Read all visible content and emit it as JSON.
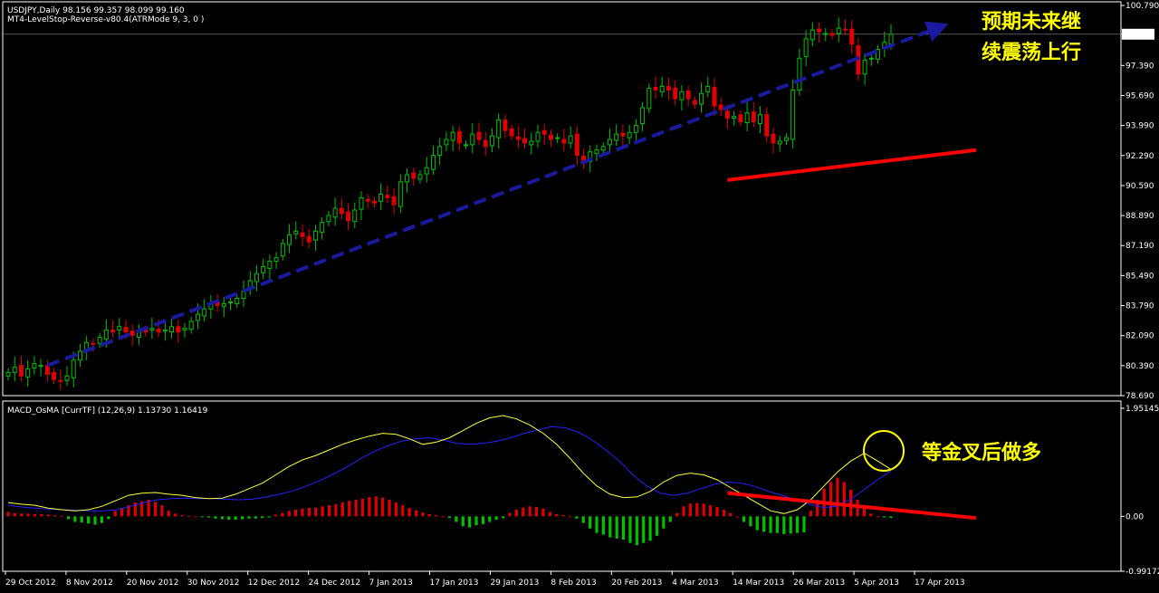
{
  "colors": {
    "background": "#000000",
    "grid": "#ffffff",
    "bull": "#00c000",
    "bear": "#e00000",
    "signal_line": "#ffff33",
    "macd_line": "#2222ff",
    "trend_arrow": "#1a1aa0",
    "highlight": "#ff0000",
    "annotation": "#ffff00"
  },
  "header": {
    "symbol_line": "USDJPY,Daily  98.156 99.357 98.099 99.160",
    "indicator_line": "MT4-LevelStop-Reverse-v80.4(ATRMode 9, 3, 0 )"
  },
  "chart_data": [
    {
      "type": "candlestick",
      "symbol": "USDJPY",
      "timeframe": "Daily",
      "ohlc_last": {
        "open": 98.156,
        "high": 99.357,
        "low": 98.099,
        "close": 99.16
      },
      "current_price_label": "99.160",
      "ylim": [
        78.69,
        100.79
      ],
      "y_ticks": [
        "100.790",
        "99.160",
        "97.390",
        "95.690",
        "93.990",
        "92.290",
        "90.590",
        "88.890",
        "87.190",
        "85.490",
        "83.790",
        "82.090",
        "80.390",
        "78.690"
      ],
      "x_ticks": [
        "29 Oct 2012",
        "8 Nov 2012",
        "20 Nov 2012",
        "30 Nov 2012",
        "12 Dec 2012",
        "24 Dec 2012",
        "7 Jan 2013",
        "17 Jan 2013",
        "29 Jan 2013",
        "8 Feb 2013",
        "20 Feb 2013",
        "4 Mar 2013",
        "14 Mar 2013",
        "26 Mar 2013",
        "5 Apr 2013",
        "17 Apr 2013"
      ],
      "close_path": [
        80.0,
        80.3,
        79.8,
        80.2,
        80.5,
        80.4,
        79.9,
        79.6,
        79.5,
        79.8,
        80.7,
        81.2,
        81.7,
        81.6,
        82.0,
        82.4,
        82.3,
        82.6,
        82.3,
        82.1,
        82.4,
        82.3,
        82.5,
        82.3,
        82.4,
        82.6,
        82.3,
        82.5,
        82.9,
        83.3,
        83.6,
        83.9,
        83.8,
        83.9,
        84.0,
        84.2,
        84.6,
        85.2,
        85.6,
        86.0,
        86.3,
        86.5,
        87.3,
        87.8,
        88.0,
        87.7,
        87.4,
        88.0,
        88.5,
        88.9,
        89.3,
        89.0,
        88.6,
        89.2,
        89.9,
        89.7,
        89.6,
        90.1,
        89.9,
        89.5,
        90.8,
        91.2,
        91.0,
        91.2,
        91.6,
        92.3,
        92.8,
        93.2,
        93.6,
        93.0,
        92.9,
        93.5,
        93.2,
        92.8,
        93.4,
        94.3,
        93.7,
        93.4,
        93.2,
        93.0,
        93.1,
        93.6,
        93.5,
        93.2,
        93.3,
        93.0,
        93.4,
        92.3,
        91.9,
        92.5,
        92.6,
        92.8,
        93.2,
        93.5,
        93.4,
        93.6,
        94.0,
        95.0,
        96.1,
        96.0,
        96.2,
        96.0,
        95.5,
        95.9,
        95.5,
        95.2,
        95.8,
        96.2,
        95.1,
        94.9,
        94.4,
        94.5,
        94.2,
        94.7,
        94.2,
        94.6,
        93.4,
        93.0,
        93.1,
        93.3,
        96.0,
        97.8,
        98.9,
        99.4,
        99.3,
        99.2,
        99.1,
        99.5,
        99.4,
        98.6,
        96.9,
        97.7,
        97.8,
        98.3,
        98.7,
        99.16
      ],
      "trend_arrow": {
        "from": {
          "index": 6,
          "price": 80.4
        },
        "to": {
          "index": 154,
          "price": 99.6
        }
      },
      "highlight_line": {
        "from": {
          "index": 110,
          "price": 90.9
        },
        "to": {
          "index": 148,
          "price": 92.6
        }
      }
    },
    {
      "type": "macd",
      "label": "MACD_OsMA [CurrTF] (12,26,9) 1.13730 1.16419",
      "ylim": [
        -0.99172,
        1.95145
      ],
      "y_ticks": [
        "1.95145",
        "0.00",
        "-0.99172"
      ],
      "osma_histogram": [
        0.08,
        0.06,
        0.05,
        0.05,
        0.04,
        0.04,
        0.03,
        0.02,
        0.01,
        -0.05,
        -0.1,
        -0.11,
        -0.13,
        -0.15,
        -0.12,
        -0.05,
        0.1,
        0.15,
        0.2,
        0.25,
        0.27,
        0.3,
        0.26,
        0.2,
        0.1,
        0.05,
        0.02,
        0.01,
        0.0,
        -0.01,
        -0.02,
        -0.04,
        -0.05,
        -0.06,
        -0.06,
        -0.05,
        -0.04,
        -0.04,
        -0.03,
        -0.02,
        0.03,
        0.06,
        0.1,
        0.12,
        0.14,
        0.15,
        0.16,
        0.18,
        0.2,
        0.22,
        0.25,
        0.28,
        0.3,
        0.32,
        0.35,
        0.36,
        0.34,
        0.3,
        0.25,
        0.2,
        0.15,
        0.11,
        0.07,
        0.04,
        0.02,
        0.0,
        -0.03,
        -0.1,
        -0.18,
        -0.2,
        -0.16,
        -0.14,
        -0.1,
        -0.06,
        -0.03,
        0.06,
        0.12,
        0.16,
        0.18,
        0.17,
        0.14,
        0.08,
        0.04,
        0.02,
        0.0,
        -0.04,
        -0.12,
        -0.22,
        -0.3,
        -0.33,
        -0.38,
        -0.4,
        -0.42,
        -0.48,
        -0.52,
        -0.48,
        -0.44,
        -0.35,
        -0.22,
        -0.1,
        0.06,
        0.18,
        0.23,
        0.24,
        0.23,
        0.2,
        0.17,
        0.12,
        0.06,
        0.0,
        -0.1,
        -0.18,
        -0.25,
        -0.28,
        -0.3,
        -0.3,
        -0.32,
        -0.31,
        -0.3,
        -0.29,
        0.1,
        0.3,
        0.5,
        0.62,
        0.7,
        0.62,
        0.48,
        0.3,
        0.15,
        0.05,
        0.0,
        -0.02,
        -0.03
      ],
      "macd_line": [
        0.2,
        0.17,
        0.15,
        0.13,
        0.12,
        0.11,
        0.1,
        0.1,
        0.12,
        0.18,
        0.25,
        0.3,
        0.32,
        0.33,
        0.32,
        0.32,
        0.31,
        0.3,
        0.31,
        0.35,
        0.4,
        0.46,
        0.55,
        0.65,
        0.77,
        0.9,
        1.05,
        1.18,
        1.28,
        1.36,
        1.4,
        1.42,
        1.38,
        1.32,
        1.3,
        1.32,
        1.36,
        1.42,
        1.5,
        1.56,
        1.62,
        1.6,
        1.52,
        1.38,
        1.2,
        1.0,
        0.75,
        0.55,
        0.42,
        0.38,
        0.42,
        0.5,
        0.58,
        0.62,
        0.6,
        0.54,
        0.45,
        0.38,
        0.3,
        0.22,
        0.16,
        0.18,
        0.3,
        0.48,
        0.66,
        0.82
      ],
      "signal_line": [
        0.25,
        0.22,
        0.2,
        0.15,
        0.12,
        0.1,
        0.12,
        0.18,
        0.28,
        0.38,
        0.42,
        0.43,
        0.4,
        0.38,
        0.34,
        0.32,
        0.33,
        0.4,
        0.5,
        0.6,
        0.75,
        0.9,
        1.02,
        1.1,
        1.2,
        1.3,
        1.38,
        1.45,
        1.5,
        1.48,
        1.4,
        1.3,
        1.34,
        1.42,
        1.55,
        1.68,
        1.78,
        1.82,
        1.76,
        1.65,
        1.5,
        1.3,
        1.05,
        0.78,
        0.55,
        0.4,
        0.34,
        0.35,
        0.45,
        0.62,
        0.74,
        0.78,
        0.75,
        0.66,
        0.52,
        0.38,
        0.24,
        0.1,
        0.05,
        0.12,
        0.3,
        0.55,
        0.8,
        1.0,
        1.14,
        1.0,
        0.85
      ],
      "highlight_line": {
        "from": {
          "index": 110,
          "value": 0.42
        },
        "to": {
          "index": 148,
          "value": -0.03
        }
      }
    }
  ],
  "annotations": {
    "top_right_line1": "预期未来继",
    "top_right_line2": "续震荡上行",
    "macd_note": "等金叉后做多"
  }
}
